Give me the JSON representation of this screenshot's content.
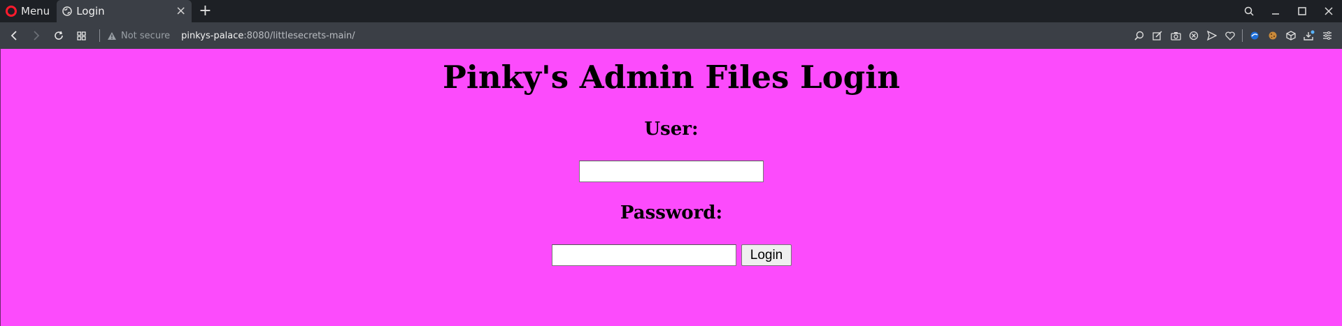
{
  "browser": {
    "menu_label": "Menu",
    "tab_title": "Login",
    "new_tab": "+",
    "close_tab": "×",
    "security_label": "Not secure",
    "url_host": "pinkys-palace",
    "url_rest": ":8080/littlesecrets-main/"
  },
  "page": {
    "background": "#fc4bfc",
    "heading": "Pinky's Admin Files Login",
    "user_label": "User:",
    "user_value": "",
    "password_label": "Password:",
    "password_value": "",
    "login_button": "Login"
  },
  "icons": {
    "toolbar": [
      "search-icon",
      "edit-icon",
      "camera-icon",
      "block-icon",
      "send-icon",
      "heart-icon",
      "extension-icon",
      "cookie-icon",
      "cube-icon",
      "download-icon",
      "easy-setup-icon"
    ]
  }
}
